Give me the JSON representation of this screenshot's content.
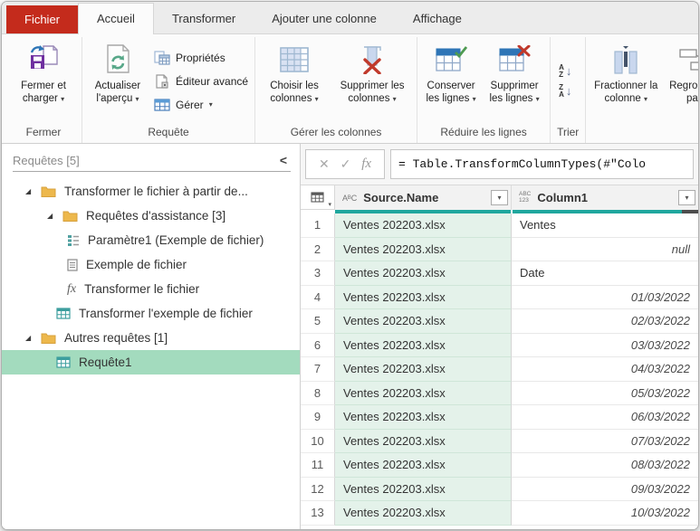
{
  "colors": {
    "file_tab_red": "#c42b1c",
    "accent_teal": "#1fa79e",
    "cell_green": "#e4f2ea",
    "selection_green": "#a3dbbe"
  },
  "tabs": {
    "file": "Fichier",
    "home": "Accueil",
    "transform": "Transformer",
    "add_column": "Ajouter une colonne",
    "view": "Affichage",
    "active": "Accueil"
  },
  "ribbon": {
    "close_load": "Fermer et charger",
    "refresh": "Actualiser l'aperçu",
    "properties": "Propriétés",
    "advanced_editor": "Éditeur avancé",
    "manage": "Gérer",
    "choose_columns": "Choisir les colonnes",
    "remove_columns": "Supprimer les colonnes",
    "keep_rows": "Conserver les lignes",
    "remove_rows": "Supprimer les lignes",
    "split_column": "Fractionner la colonne",
    "group_by": "Regrouper par",
    "groups": {
      "close": "Fermer",
      "query": "Requête",
      "manage_columns": "Gérer les colonnes",
      "reduce_rows": "Réduire les lignes",
      "sort": "Trier"
    }
  },
  "icons": {
    "caret": "▾",
    "collapse_chevron": "<",
    "triangle_expanded": "◢",
    "cancel": "✕",
    "check": "✓",
    "fx": "fx",
    "arrow_down": "↓",
    "sort_az": [
      "A",
      "Z"
    ],
    "sort_za": [
      "Z",
      "A"
    ]
  },
  "sidebar": {
    "title": "Requêtes [5]",
    "items": [
      {
        "label": "Transformer le fichier à partir de...",
        "type": "folder",
        "level": 1,
        "expanded": true
      },
      {
        "label": "Requêtes d'assistance [3]",
        "type": "folder",
        "level": 2,
        "expanded": true
      },
      {
        "label": "Paramètre1 (Exemple de fichier)",
        "type": "parameter",
        "level": 3
      },
      {
        "label": "Exemple de fichier",
        "type": "document",
        "level": 3
      },
      {
        "label": "Transformer le fichier",
        "type": "function",
        "level": 3
      },
      {
        "label": "Transformer l'exemple de fichier",
        "type": "table",
        "level": 2
      },
      {
        "label": "Autres requêtes [1]",
        "type": "folder",
        "level": 1,
        "expanded": true
      },
      {
        "label": "Requête1",
        "type": "table",
        "level": 2,
        "selected": true
      }
    ]
  },
  "formula_bar": {
    "formula": "= Table.TransformColumnTypes(#\"Colo"
  },
  "table": {
    "columns": [
      {
        "type_icon": "AᴮC",
        "name": "Source.Name"
      },
      {
        "type_icon_top": "ABC",
        "type_icon_bottom": "123",
        "name": "Column1"
      }
    ],
    "rows": [
      {
        "num": "1",
        "source": "Ventes 202203.xlsx",
        "value": "Ventes",
        "align": "left"
      },
      {
        "num": "2",
        "source": "Ventes 202203.xlsx",
        "value": "null",
        "align": "right"
      },
      {
        "num": "3",
        "source": "Ventes 202203.xlsx",
        "value": "Date",
        "align": "left"
      },
      {
        "num": "4",
        "source": "Ventes 202203.xlsx",
        "value": "01/03/2022",
        "align": "right"
      },
      {
        "num": "5",
        "source": "Ventes 202203.xlsx",
        "value": "02/03/2022",
        "align": "right"
      },
      {
        "num": "6",
        "source": "Ventes 202203.xlsx",
        "value": "03/03/2022",
        "align": "right"
      },
      {
        "num": "7",
        "source": "Ventes 202203.xlsx",
        "value": "04/03/2022",
        "align": "right"
      },
      {
        "num": "8",
        "source": "Ventes 202203.xlsx",
        "value": "05/03/2022",
        "align": "right"
      },
      {
        "num": "9",
        "source": "Ventes 202203.xlsx",
        "value": "06/03/2022",
        "align": "right"
      },
      {
        "num": "10",
        "source": "Ventes 202203.xlsx",
        "value": "07/03/2022",
        "align": "right"
      },
      {
        "num": "11",
        "source": "Ventes 202203.xlsx",
        "value": "08/03/2022",
        "align": "right"
      },
      {
        "num": "12",
        "source": "Ventes 202203.xlsx",
        "value": "09/03/2022",
        "align": "right"
      },
      {
        "num": "13",
        "source": "Ventes 202203.xlsx",
        "value": "10/03/2022",
        "align": "right"
      }
    ]
  }
}
